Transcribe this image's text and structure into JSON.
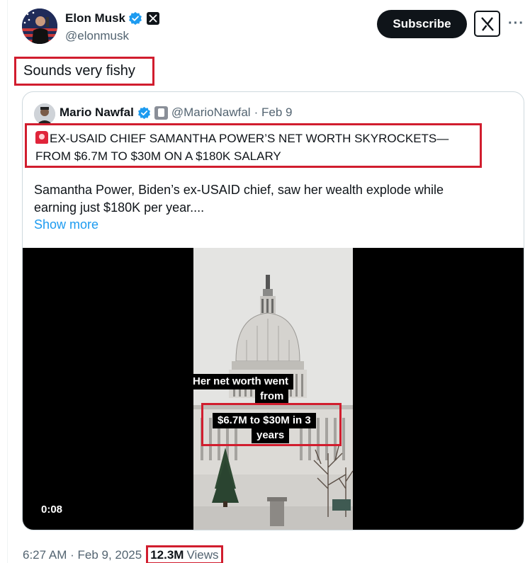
{
  "author": {
    "name": "Elon Musk",
    "handle": "@elonmusk",
    "subscribe_label": "Subscribe",
    "more_label": "···"
  },
  "tweet": {
    "text": "Sounds very fishy"
  },
  "quoted": {
    "name": "Mario Nawfal",
    "handle": "@MarioNawfal",
    "date": "· Feb 9",
    "headline_line1": "EX-USAID CHIEF SAMANTHA POWER’S NET WORTH SKYROCKETS—",
    "headline_line2": "FROM $6.7M TO $30M ON A $180K SALARY",
    "body_line1": "Samantha Power, Biden’s ex-USAID chief, saw her wealth explode while",
    "body_line2": "earning just $180K per year....",
    "show_more": "Show more"
  },
  "video": {
    "duration": "0:08",
    "caption_line1": "Her net worth went",
    "caption_line2": "from",
    "caption_line3": "$6.7M to $30M in 3",
    "caption_line4": "years"
  },
  "footer": {
    "time_date": "6:27 AM · Feb 9, 2025",
    "views_count": "12.3M",
    "views_label": "Views"
  },
  "colors": {
    "verified_blue": "#1d9bf0",
    "highlight_red": "#d11d2e",
    "text_primary": "#0f1419",
    "text_secondary": "#536471"
  }
}
